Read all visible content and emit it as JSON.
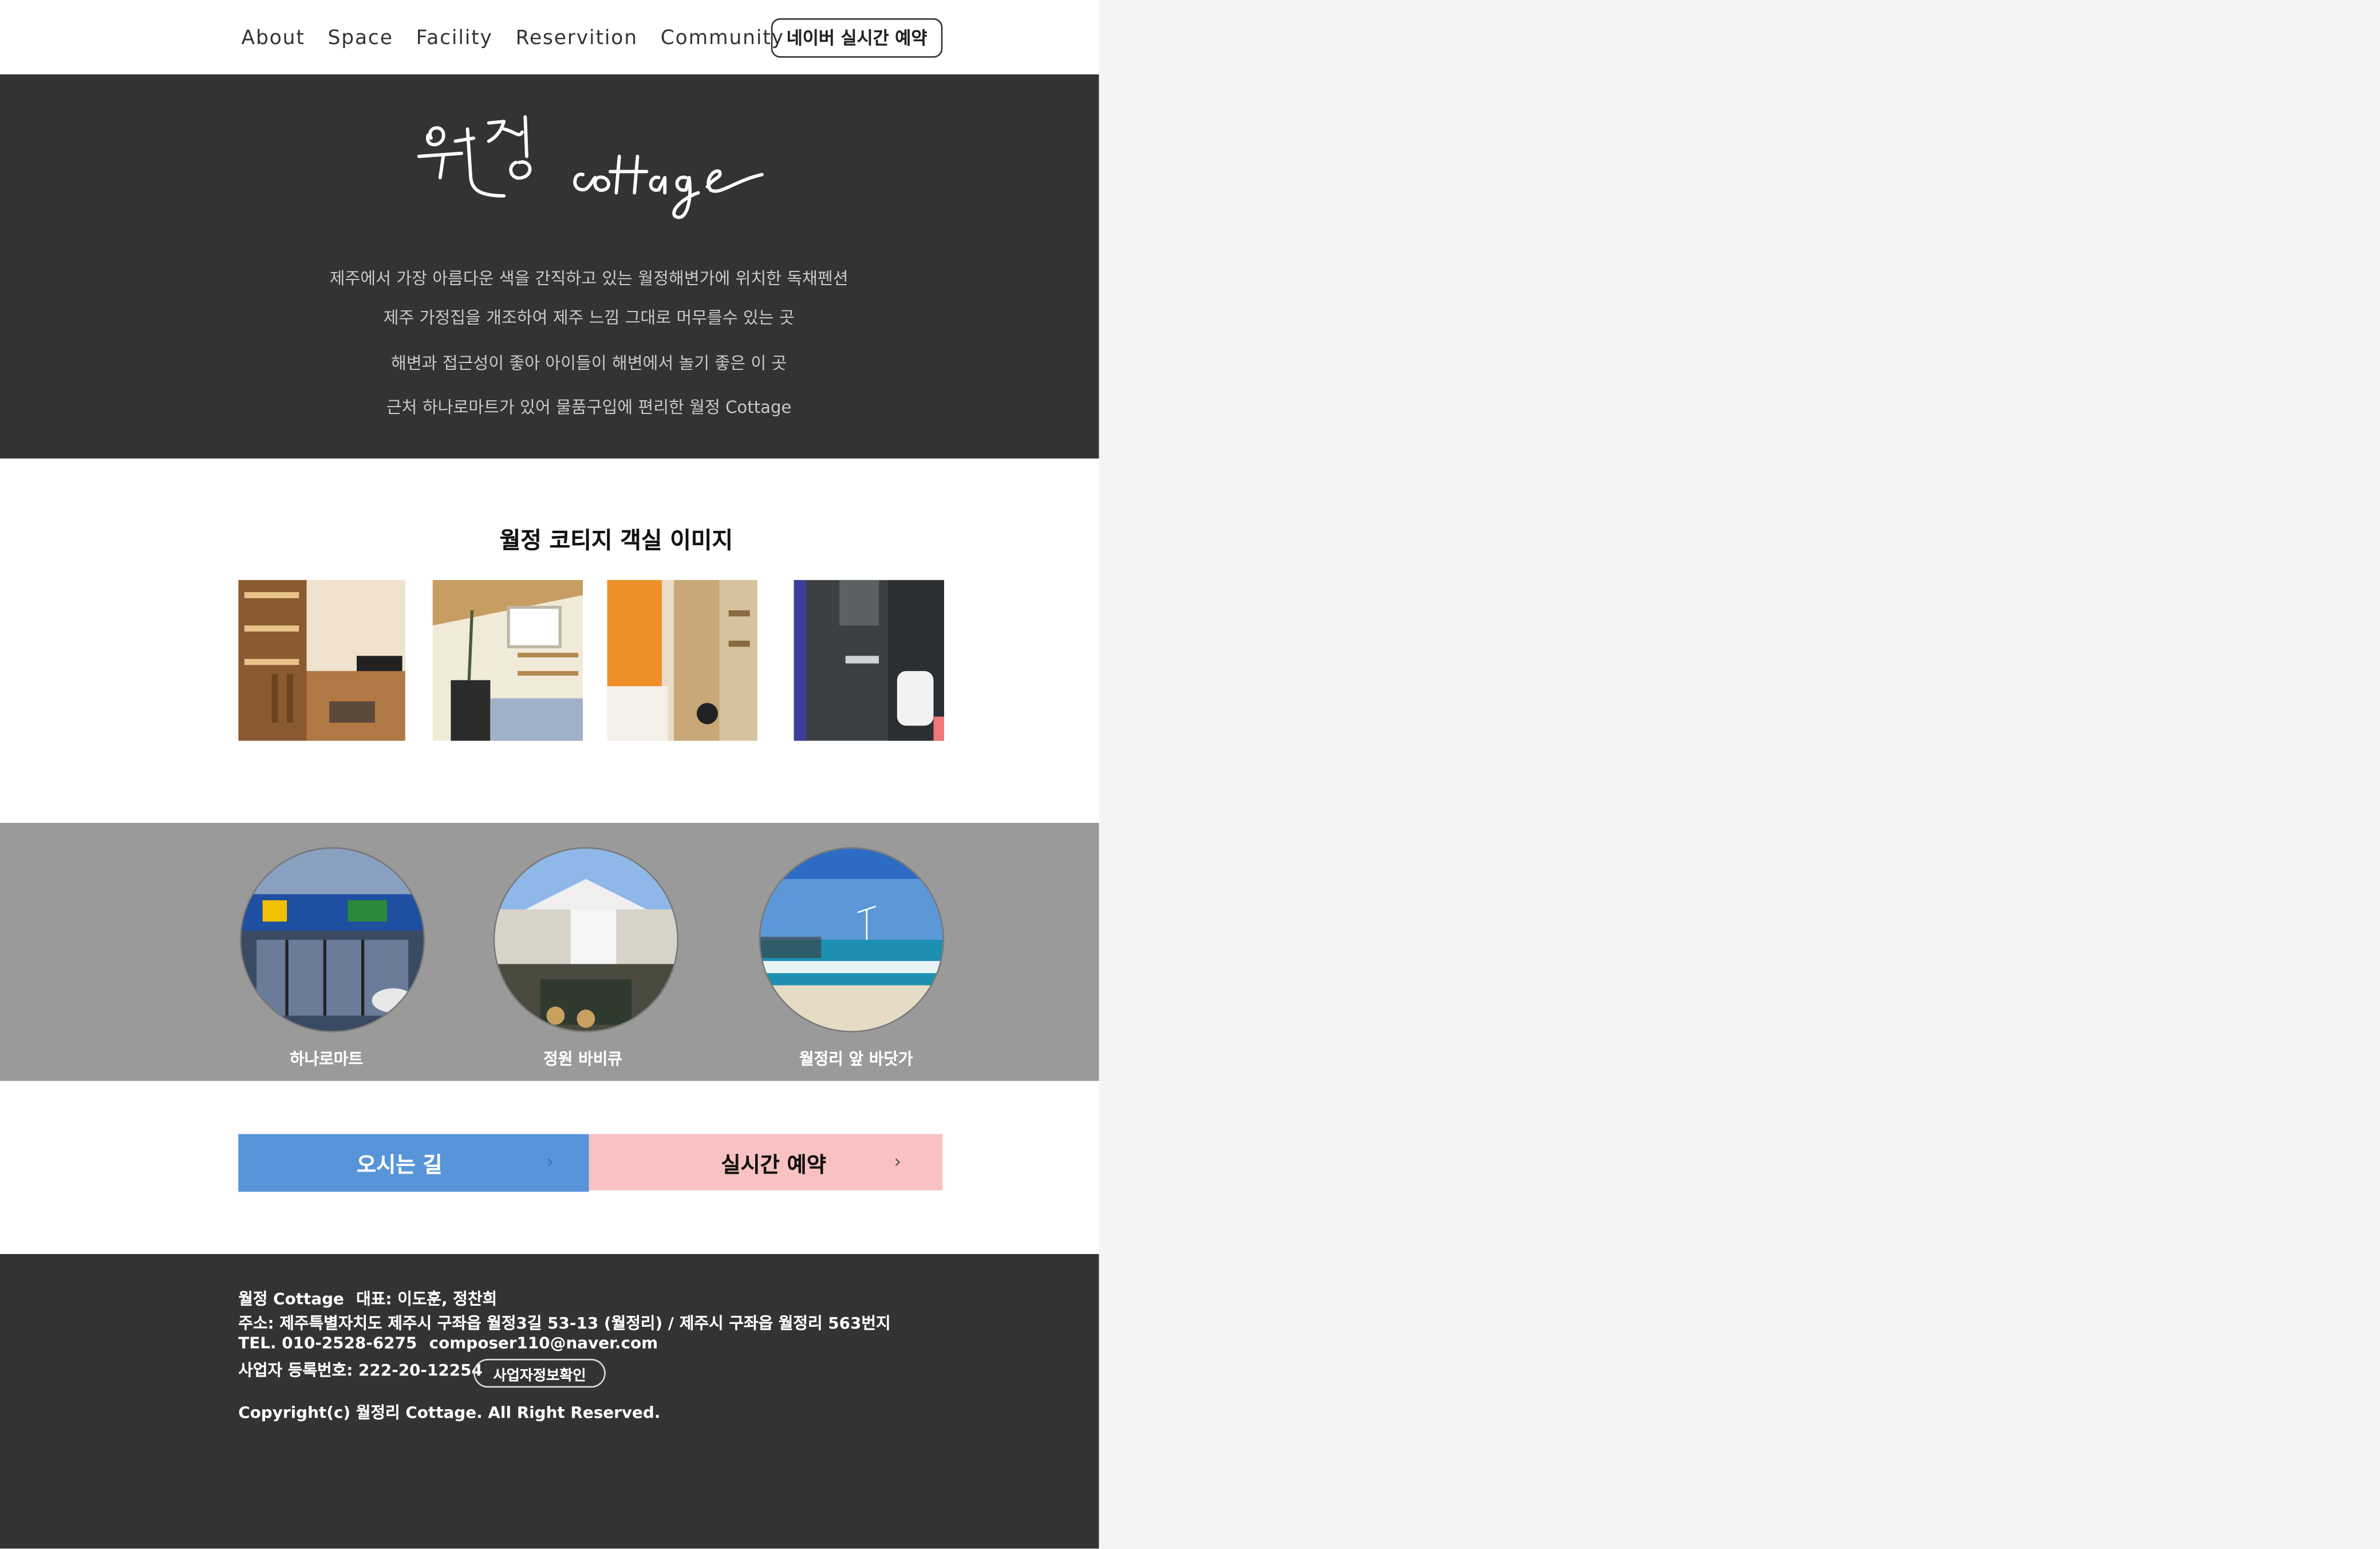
{
  "nav": {
    "items": [
      {
        "label": "About"
      },
      {
        "label": "Space"
      },
      {
        "label": "Facility"
      },
      {
        "label": "Reservition"
      },
      {
        "label": "Community"
      }
    ],
    "naver_button": "네이버 실시간 예약"
  },
  "hero": {
    "intro_lines": [
      "제주에서  가장 아름다운 색을 간직하고 있는 월정해변가에 위치한 독채펜션",
      "제주 가정집을 개조하여 제주 느낌 그대로 머무를수 있는 곳",
      "해변과 접근성이 좋아 아이들이 해변에서 놀기 좋은 이 곳",
      "근처 하나로마트가 있어 물품구입에 편리한 월정 Cottage"
    ]
  },
  "rooms": {
    "title": "월정 코티지 객실 이미지"
  },
  "attractions": [
    {
      "label": "하나로마트"
    },
    {
      "label": "정원 바비큐"
    },
    {
      "label": "월정리 앞 바닷가"
    }
  ],
  "actions": {
    "directions": "오시는 길",
    "reserve": "실시간 예약",
    "chevron": "›"
  },
  "footer": {
    "name": "월정 Cottage",
    "ceo": "대표: 이도훈, 정찬희",
    "address": "주소: 제주특별자치도 제주시 구좌읍 월정3길 53-13 (월정리) / 제주시 구좌읍 월정리 563번지",
    "tel": "TEL. 010-2528-6275",
    "email": "composer110@naver.com",
    "biz_no": "사업자 등록번호: 222-20-12254",
    "biz_button": "사업자정보확인",
    "copyright": "Copyright(c) 월정리 Cottage. All Right Reserved."
  },
  "colors": {
    "hero_bg": "#333333",
    "band_bg": "#9a9a9a",
    "directions_bg": "#5895d8",
    "reserve_bg": "#f9c1c1",
    "footer_bg": "#333333"
  }
}
